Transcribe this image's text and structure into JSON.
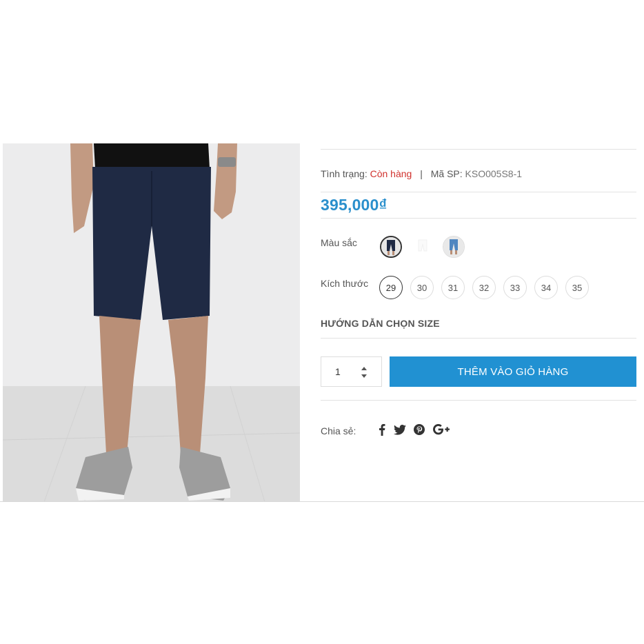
{
  "product": {
    "status_label": "Tình trạng:",
    "status_value": "Còn hàng",
    "separator": "|",
    "sku_label": "Mã SP:",
    "sku_value": "KSO005S8-1",
    "price": "395,000₫"
  },
  "options": {
    "color_label": "Màu sắc",
    "colors": [
      {
        "name": "navy",
        "selected": true
      },
      {
        "name": "white",
        "selected": false
      },
      {
        "name": "light-blue",
        "selected": false
      }
    ],
    "size_label": "Kích thước",
    "sizes": [
      "29",
      "30",
      "31",
      "32",
      "33",
      "34",
      "35"
    ],
    "selected_size": "29",
    "size_guide": "HƯỚNG DẪN CHỌN SIZE"
  },
  "cart": {
    "quantity": "1",
    "add_to_cart_label": "THÊM VÀO GIỎ HÀNG"
  },
  "share": {
    "label": "Chia sẻ:",
    "icons": [
      "facebook-icon",
      "twitter-icon",
      "pinterest-icon",
      "google-plus-icon"
    ]
  },
  "colors": {
    "price": "#2a8fcc",
    "in_stock": "#d0312d",
    "button": "#2191d2"
  }
}
